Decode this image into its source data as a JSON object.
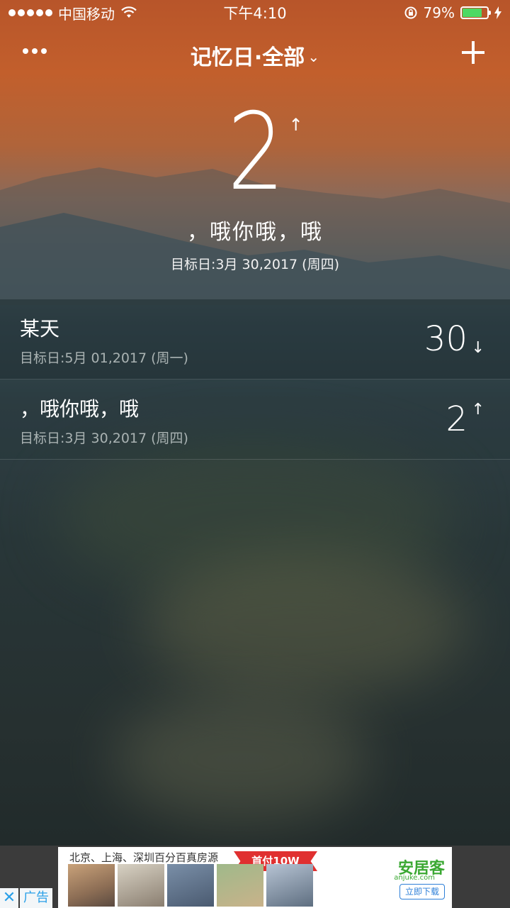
{
  "status_bar": {
    "carrier": "中国移动",
    "time": "下午4:10",
    "battery_percent": "79%",
    "battery_level": 0.79
  },
  "nav": {
    "title": "记忆日·全部",
    "chevron_icon": "chevron-down-icon",
    "more_icon": "more-dots-icon",
    "add_icon": "plus-icon"
  },
  "hero": {
    "days": "2",
    "direction_arrow": "↑",
    "event_name": "，哦你哦，哦",
    "target_date": "目标日:3月 30,2017 (周四)"
  },
  "events": [
    {
      "title": "某天",
      "target_date": "目标日:5月 01,2017 (周一)",
      "days": "30",
      "arrow": "↓"
    },
    {
      "title": "，哦你哦，哦",
      "target_date": "目标日:3月 30,2017 (周四)",
      "days": "2",
      "arrow": "↑"
    }
  ],
  "ad": {
    "headline": "北京、上海、深圳百分百真房源",
    "promo": "首付10W",
    "brand": "安居客",
    "brand_sub": "anjuke.com",
    "download": "立即下载",
    "close_label": "✕",
    "ad_label": "广告"
  },
  "colors": {
    "battery_fill": "#4cd964",
    "ad_accent": "#2aa0e8",
    "brand_green": "#3aa832",
    "promo_red": "#e03030"
  }
}
